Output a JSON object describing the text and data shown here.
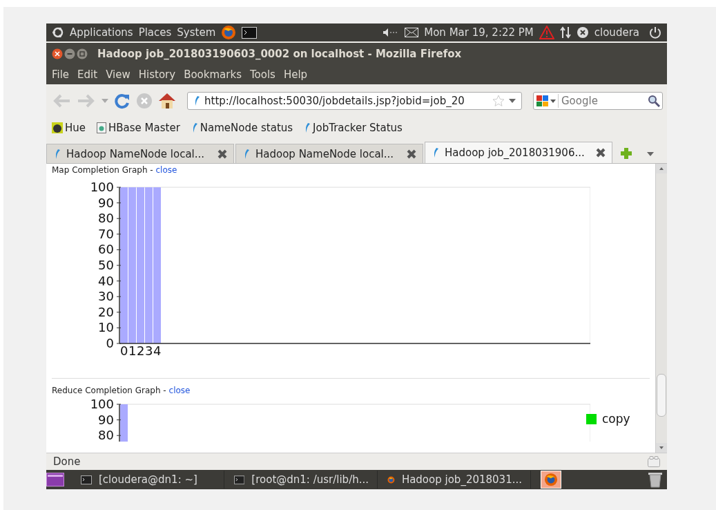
{
  "top_panel": {
    "menus": [
      "Applications",
      "Places",
      "System"
    ],
    "clock": "Mon Mar 19,  2:22 PM",
    "user": "cloudera"
  },
  "window": {
    "title": "Hadoop job_201803190603_0002 on localhost - Mozilla Firefox"
  },
  "menu_bar": [
    "File",
    "Edit",
    "View",
    "History",
    "Bookmarks",
    "Tools",
    "Help"
  ],
  "navigation": {
    "url": "http://localhost:50030/jobdetails.jsp?jobid=job_20",
    "search_placeholder": "Google"
  },
  "bookmarks": [
    {
      "label": "Hue",
      "kind": "hue"
    },
    {
      "label": "HBase Master",
      "kind": "page"
    },
    {
      "label": "NameNode status",
      "kind": "hadoop"
    },
    {
      "label": "JobTracker Status",
      "kind": "hadoop"
    }
  ],
  "tabs": [
    {
      "label": "Hadoop NameNode local...",
      "selected": false
    },
    {
      "label": "Hadoop NameNode local...",
      "selected": false
    },
    {
      "label": "Hadoop job_2018031906...",
      "selected": true
    }
  ],
  "sections": [
    {
      "title": "Map Completion Graph -",
      "link": "close",
      "chart_data": {
        "type": "bar",
        "categories": [
          "0",
          "1",
          "2",
          "3",
          "4"
        ],
        "values": [
          100,
          100,
          100,
          100,
          100
        ],
        "ylim": [
          0,
          100
        ],
        "yticks": [
          0,
          10,
          20,
          30,
          40,
          50,
          60,
          70,
          80,
          90,
          100
        ]
      }
    },
    {
      "title": "Reduce Completion Graph -",
      "link": "close",
      "cut_chart": {
        "kind": "bar",
        "y_labels": [
          "100",
          "90",
          "80"
        ]
      },
      "legend": [
        {
          "name": "copy",
          "color": "#00dd00"
        }
      ]
    }
  ],
  "status_bar": {
    "text": "Done"
  },
  "taskbar": [
    {
      "label": "[cloudera@dn1: ~]",
      "kind": "terminal"
    },
    {
      "label": "[root@dn1: /usr/lib/h...",
      "kind": "terminal"
    },
    {
      "label": "Hadoop job_2018031...",
      "kind": "browser"
    }
  ]
}
